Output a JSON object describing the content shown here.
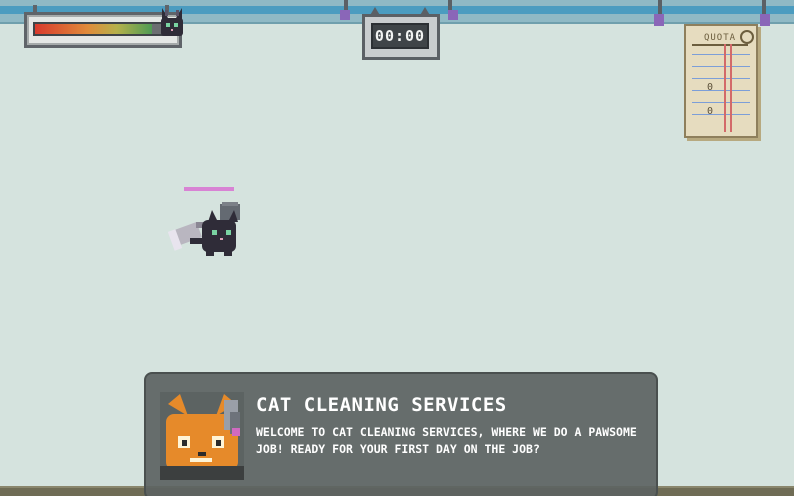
{
  "hud": {
    "health": {
      "level": 0.9,
      "icon": "black-cat-head-icon"
    },
    "timer": {
      "display": "00:00"
    },
    "quota": {
      "title": "QUOTA",
      "values": [
        "0",
        "0"
      ]
    }
  },
  "player": {
    "sprite": "black-cat-with-vacuum",
    "bar_color": "#d883d4"
  },
  "dialog": {
    "title": "CAT CLEANING SERVICES",
    "text": "WELCOME TO CAT CLEANING SERVICES, WHERE WE DO A PAWSOME JOB! READY FOR YOUR FIRST DAY ON THE JOB?",
    "portrait": "orange-cat-with-headset-icon"
  },
  "colors": {
    "background": "#d5e3de",
    "topbar": "#4b9cc0",
    "dialog_bg": "#5c6362",
    "text": "#ffffff"
  }
}
